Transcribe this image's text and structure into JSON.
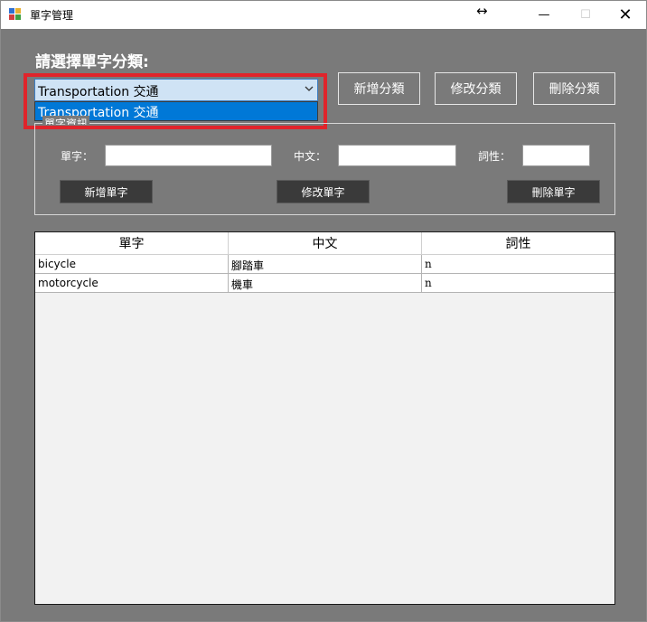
{
  "window": {
    "title": "單字管理",
    "resize_glyph": "↔",
    "minimize_glyph": "—",
    "maximize_glyph": "☐",
    "close_glyph": "✕"
  },
  "category": {
    "label": "請選擇單字分類:",
    "selected": "Transportation 交通",
    "dropdown_options": [
      "Transportation 交通"
    ],
    "arrow_icon": "chevron-down-icon",
    "add_label": "新增分類",
    "edit_label": "修改分類",
    "delete_label": "刪除分類"
  },
  "word_info": {
    "group_title": "單字資訊",
    "word_label": "單字：",
    "chinese_label": "中文：",
    "pos_label": "詞性：",
    "word_value": "",
    "chinese_value": "",
    "pos_value": "",
    "add_label": "新增單字",
    "edit_label": "修改單字",
    "delete_label": "刪除單字"
  },
  "grid": {
    "columns": [
      "單字",
      "中文",
      "詞性"
    ],
    "rows": [
      [
        "bicycle",
        "腳踏車",
        "n"
      ],
      [
        "motorcycle",
        "機車",
        "n"
      ]
    ]
  },
  "colors": {
    "background": "#7a7a7a",
    "highlight": "#e0242b",
    "selection": "#0078d7"
  }
}
